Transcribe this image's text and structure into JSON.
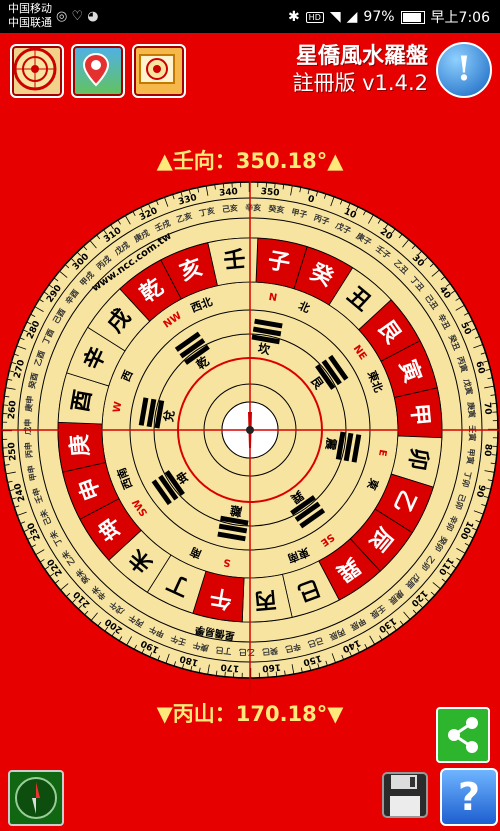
{
  "status": {
    "carrier1": "中国移动",
    "carrier2": "中国联通",
    "battery": "97%",
    "time": "早上7:06"
  },
  "app": {
    "title": "星僑風水羅盤",
    "subtitle": "註冊版 v1.4.2"
  },
  "readings": {
    "top": "▲壬向：350.18°▲",
    "bottom": "▼丙山：170.18°▼"
  },
  "compass": {
    "mountains": [
      "子",
      "癸",
      "丑",
      "艮",
      "寅",
      "甲",
      "卯",
      "乙",
      "辰",
      "巽",
      "巳",
      "丙",
      "午",
      "丁",
      "未",
      "坤",
      "申",
      "庚",
      "酉",
      "辛",
      "戌",
      "乾",
      "亥",
      "壬"
    ],
    "red_mountains": [
      "子",
      "癸",
      "艮",
      "寅",
      "甲",
      "乙",
      "辰",
      "巽",
      "午",
      "坤",
      "申",
      "庚",
      "乾",
      "亥"
    ],
    "directions": [
      "N",
      "NE",
      "E",
      "SE",
      "S",
      "SW",
      "W",
      "NW"
    ],
    "dir_cn": [
      "北",
      "東北",
      "東",
      "東南",
      "南",
      "西南",
      "西",
      "西北"
    ],
    "trigrams": [
      "坎",
      "艮",
      "震",
      "巽",
      "離",
      "坤",
      "兌",
      "乾"
    ],
    "brand": "星僑易學",
    "website": "www.ncc.com.tw",
    "degree_labels": [
      "0",
      "10",
      "20",
      "30",
      "40",
      "50",
      "60",
      "70",
      "80",
      "90",
      "100",
      "110",
      "120",
      "130",
      "140",
      "150",
      "160",
      "170",
      "180",
      "190",
      "200",
      "210",
      "220",
      "230",
      "240",
      "250",
      "260",
      "270",
      "280",
      "290",
      "300",
      "310",
      "320",
      "330",
      "340",
      "350"
    ],
    "ring_chars": [
      "甲子",
      "丙子",
      "戊子",
      "庚子",
      "壬子",
      "乙丑",
      "丁丑",
      "己丑",
      "辛丑",
      "癸丑",
      "丙寅",
      "戊寅",
      "庚寅",
      "壬寅",
      "甲寅",
      "丁卯",
      "己卯",
      "辛卯",
      "癸卯",
      "乙卯",
      "戊辰",
      "庚辰",
      "壬辰",
      "甲辰",
      "丙辰",
      "己巳",
      "辛巳",
      "癸巳",
      "乙巳",
      "丁巳",
      "庚午",
      "壬午",
      "甲午",
      "丙午",
      "戊午",
      "辛未",
      "癸未",
      "乙未",
      "丁未",
      "己未",
      "壬申",
      "甲申",
      "丙申",
      "戊申",
      "庚申",
      "癸酉",
      "乙酉",
      "丁酉",
      "己酉",
      "辛酉",
      "甲戌",
      "丙戌",
      "戊戌",
      "庚戌",
      "壬戌",
      "乙亥",
      "丁亥",
      "己亥",
      "辛亥",
      "癸亥"
    ]
  },
  "colors": {
    "background": "#e60000",
    "dial": "#f7e4a0",
    "red": "#d90000",
    "reading": "#ffe97a"
  },
  "icons": [
    "compass-icon",
    "map-pin-icon",
    "photo-icon",
    "info-icon",
    "share-icon",
    "save-icon",
    "help-icon",
    "bluetooth-icon",
    "wifi-icon",
    "signal-icon",
    "battery-icon"
  ]
}
